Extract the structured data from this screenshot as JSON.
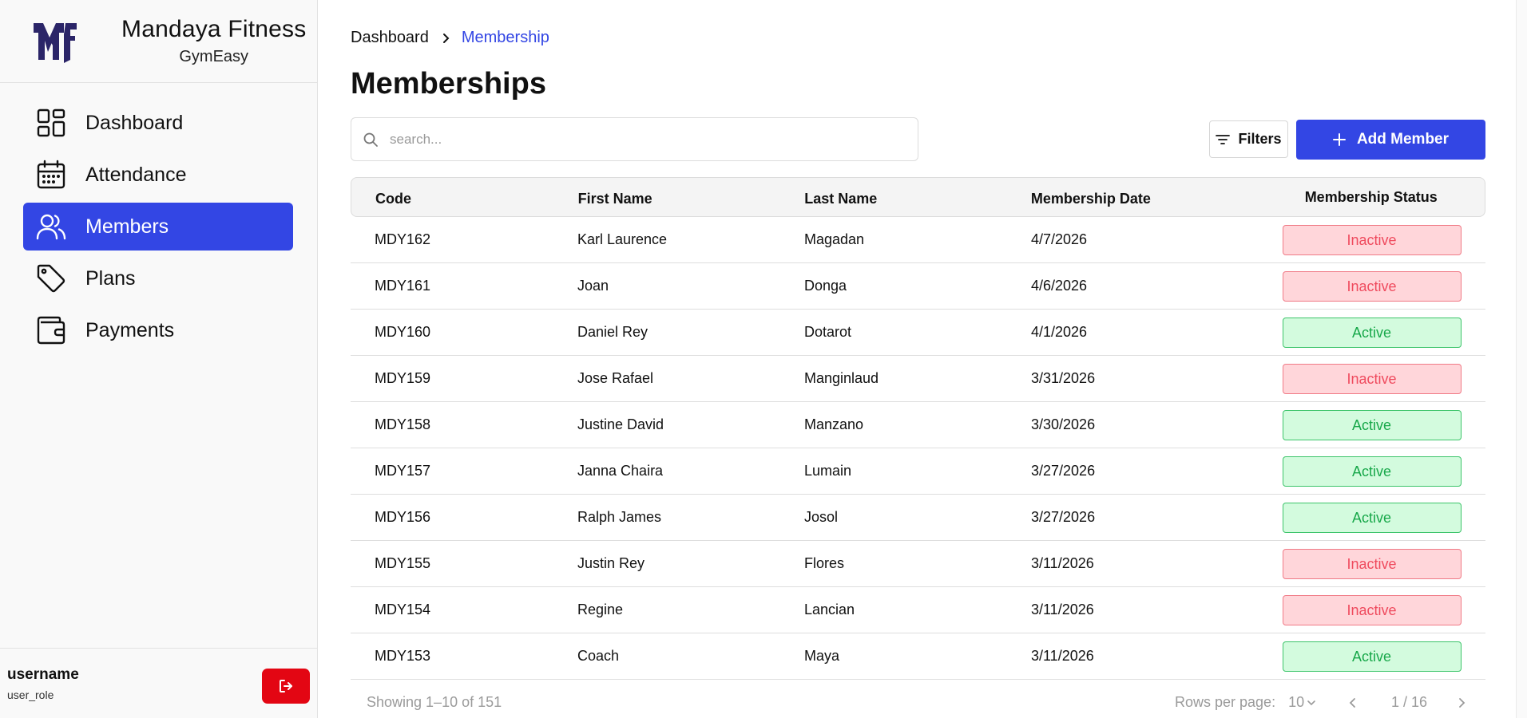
{
  "brand": {
    "name": "Mandaya Fitness",
    "subtitle": "GymEasy",
    "logo_color": "#2b2568"
  },
  "sidebar": {
    "items": [
      {
        "label": "Dashboard",
        "icon": "dashboard-icon"
      },
      {
        "label": "Attendance",
        "icon": "calendar-icon"
      },
      {
        "label": "Members",
        "icon": "users-icon",
        "active": true
      },
      {
        "label": "Plans",
        "icon": "tag-icon"
      },
      {
        "label": "Payments",
        "icon": "wallet-icon"
      }
    ],
    "active_color": "#3346e4"
  },
  "user": {
    "name": "username",
    "role": "user_role",
    "logout_icon": "logout-icon",
    "logout_color": "#e30613"
  },
  "breadcrumb": {
    "items": [
      "Dashboard",
      "Membership"
    ]
  },
  "page": {
    "title": "Memberships"
  },
  "search": {
    "placeholder": "search...",
    "value": ""
  },
  "toolbar": {
    "filters_label": "Filters",
    "add_label": "Add Member"
  },
  "table": {
    "headers": {
      "code": "Code",
      "first_name": "First Name",
      "last_name": "Last Name",
      "date": "Membership Date",
      "status": "Membership Status"
    },
    "rows": [
      {
        "code": "MDY162",
        "first_name": "Karl Laurence",
        "last_name": "Magadan",
        "date": "4/7/2026",
        "status": "Inactive"
      },
      {
        "code": "MDY161",
        "first_name": "Joan",
        "last_name": "Donga",
        "date": "4/6/2026",
        "status": "Inactive"
      },
      {
        "code": "MDY160",
        "first_name": "Daniel Rey",
        "last_name": "Dotarot",
        "date": "4/1/2026",
        "status": "Active"
      },
      {
        "code": "MDY159",
        "first_name": "Jose Rafael",
        "last_name": "Manginlaud",
        "date": "3/31/2026",
        "status": "Inactive"
      },
      {
        "code": "MDY158",
        "first_name": "Justine David",
        "last_name": "Manzano",
        "date": "3/30/2026",
        "status": "Active"
      },
      {
        "code": "MDY157",
        "first_name": "Janna Chaira",
        "last_name": "Lumain",
        "date": "3/27/2026",
        "status": "Active"
      },
      {
        "code": "MDY156",
        "first_name": "Ralph James",
        "last_name": "Josol",
        "date": "3/27/2026",
        "status": "Active"
      },
      {
        "code": "MDY155",
        "first_name": "Justin Rey",
        "last_name": "Flores",
        "date": "3/11/2026",
        "status": "Inactive"
      },
      {
        "code": "MDY154",
        "first_name": "Regine",
        "last_name": "Lancian",
        "date": "3/11/2026",
        "status": "Inactive"
      },
      {
        "code": "MDY153",
        "first_name": "Coach",
        "last_name": "Maya",
        "date": "3/11/2026",
        "status": "Active"
      }
    ]
  },
  "footer": {
    "showing": "Showing 1–10 of 151",
    "rows_per_page_label": "Rows per page:",
    "rows_per_page_value": "10",
    "page_info": "1 / 16"
  }
}
